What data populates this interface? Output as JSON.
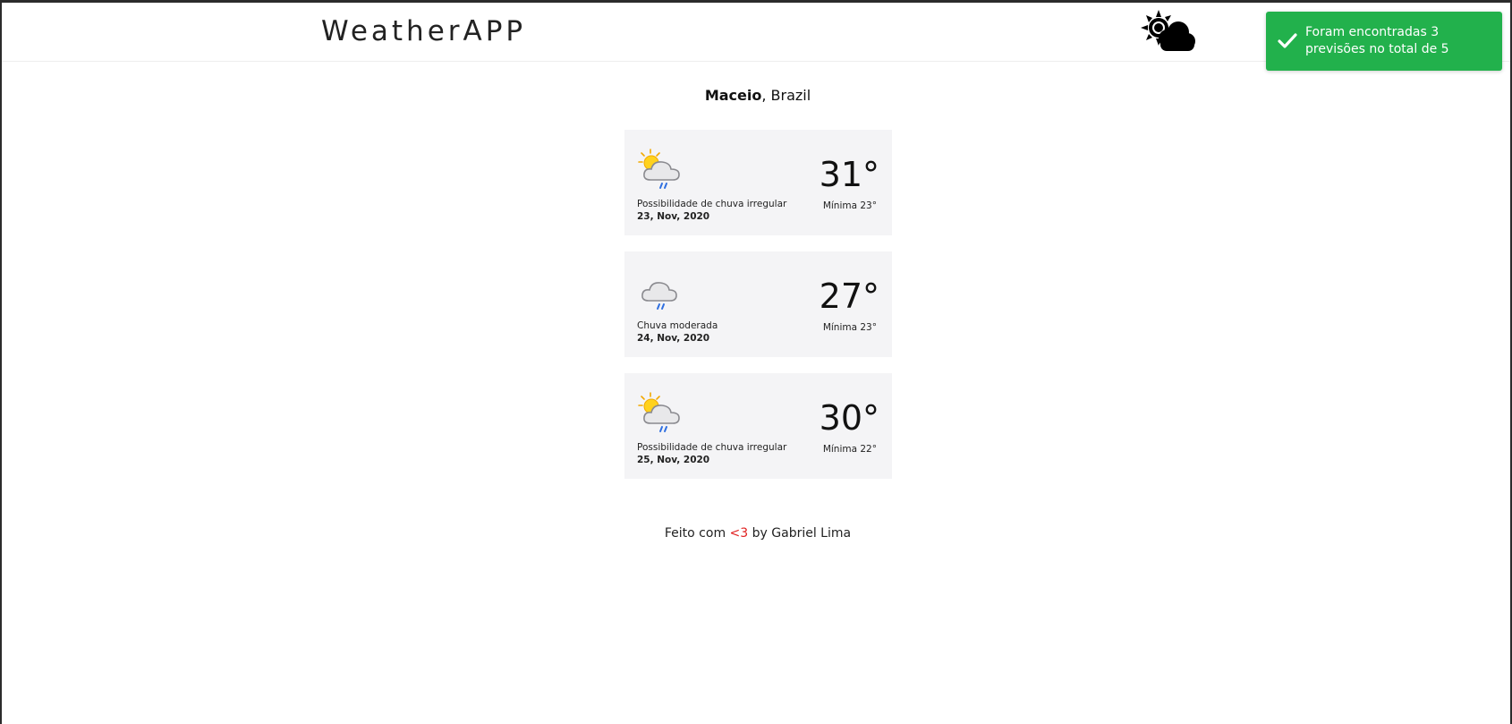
{
  "header": {
    "brand": "WeatherAPP",
    "logo_icon": "sun-cloud-icon"
  },
  "toast": {
    "message": "Foram encontradas 3 previsões no total de 5",
    "icon": "check-icon",
    "color": "#22b14c"
  },
  "location": {
    "city": "Maceio",
    "separator": ",",
    "country": "Brazil"
  },
  "forecasts": [
    {
      "icon": "sun-cloud-rain-icon",
      "description": "Possibilidade de chuva irregular",
      "date": "23, Nov, 2020",
      "temp": "31°",
      "min": "Mínima 23°"
    },
    {
      "icon": "cloud-rain-icon",
      "description": "Chuva moderada",
      "date": "24, Nov, 2020",
      "temp": "27°",
      "min": "Mínima 23°"
    },
    {
      "icon": "sun-cloud-rain-icon",
      "description": "Possibilidade de chuva irregular",
      "date": "25, Nov, 2020",
      "temp": "30°",
      "min": "Mínima 22°"
    }
  ],
  "footer": {
    "prefix": "Feito com",
    "heart": "<3",
    "suffix": "by Gabriel Lima",
    "heart_color": "#e02020"
  }
}
